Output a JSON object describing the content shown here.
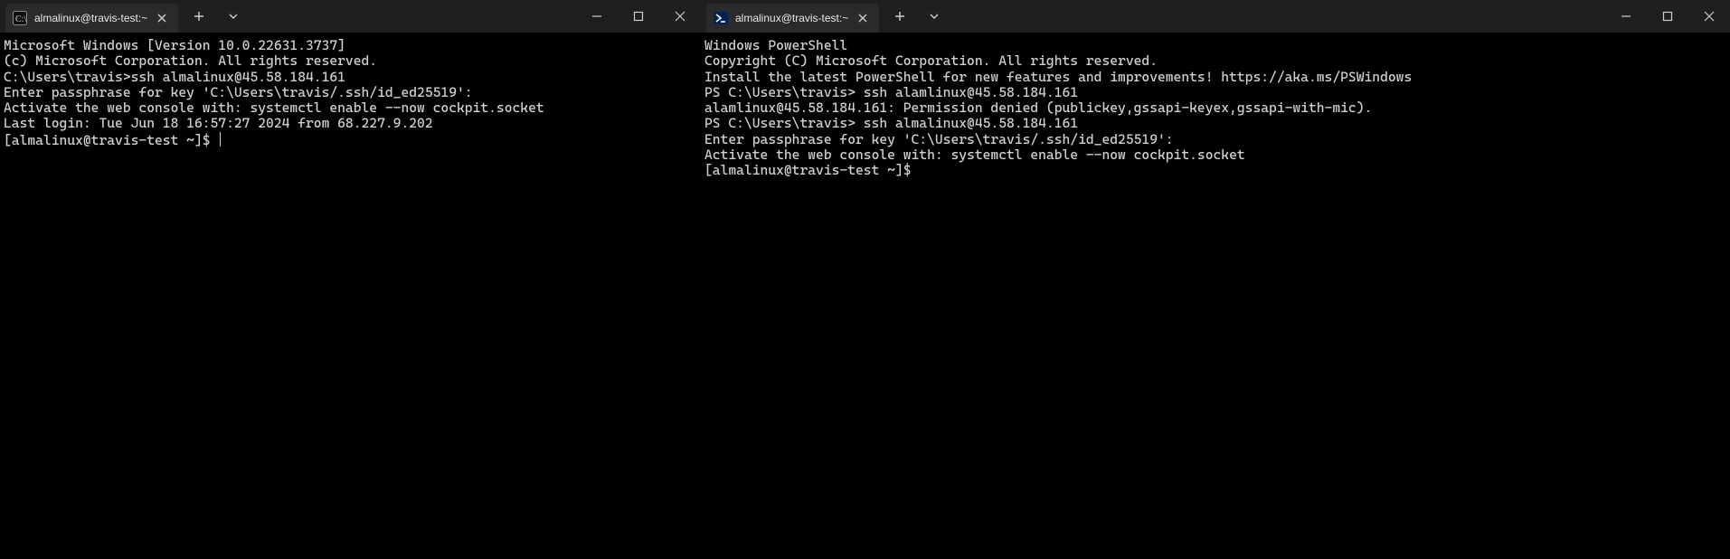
{
  "left": {
    "tab": {
      "title": "almalinux@travis-test:~",
      "icon": "cmd-icon"
    },
    "lines": [
      "Microsoft Windows [Version 10.0.22631.3737]",
      "(c) Microsoft Corporation. All rights reserved.",
      "",
      "C:\\Users\\travis>ssh almalinux@45.58.184.161",
      "Enter passphrase for key 'C:\\Users\\travis/.ssh/id_ed25519':",
      "Activate the web console with: systemctl enable --now cockpit.socket",
      "",
      "Last login: Tue Jun 18 16:57:27 2024 from 68.227.9.202",
      "[almalinux@travis-test ~]$ "
    ]
  },
  "right": {
    "tab": {
      "title": "almalinux@travis-test:~",
      "icon": "powershell-icon"
    },
    "lines": [
      "Windows PowerShell",
      "Copyright (C) Microsoft Corporation. All rights reserved.",
      "",
      "Install the latest PowerShell for new features and improvements! https://aka.ms/PSWindows",
      "",
      "PS C:\\Users\\travis> ssh alamlinux@45.58.184.161",
      "alamlinux@45.58.184.161: Permission denied (publickey,gssapi-keyex,gssapi-with-mic).",
      "PS C:\\Users\\travis> ssh almalinux@45.58.184.161",
      "Enter passphrase for key 'C:\\Users\\travis/.ssh/id_ed25519':",
      "Activate the web console with: systemctl enable --now cockpit.socket",
      "",
      "[almalinux@travis-test ~]$"
    ]
  },
  "icons": {
    "close_x": "×",
    "plus": "+",
    "chevron": "⌄",
    "minimize": "—"
  }
}
